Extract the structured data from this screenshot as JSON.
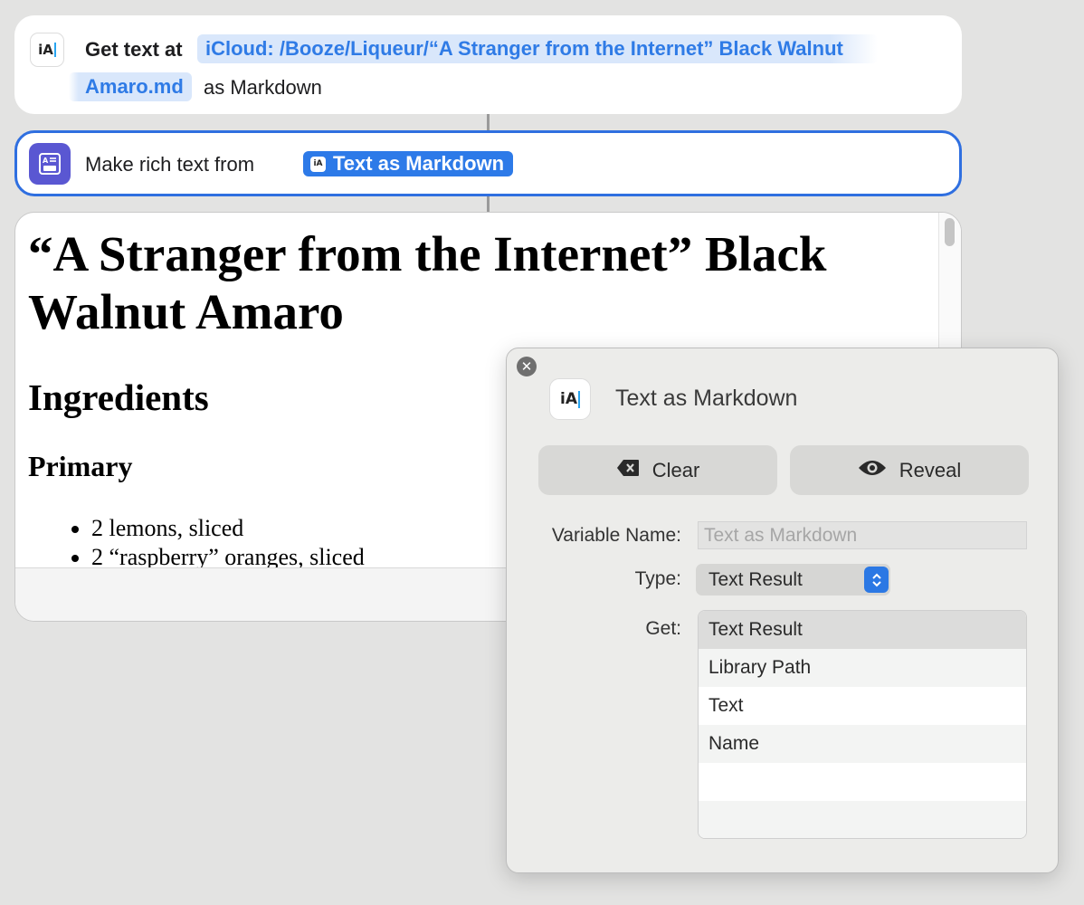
{
  "action1": {
    "label": "Get text at",
    "path_line1": "iCloud: /Booze/Liqueur/“A Stranger from the Internet” Black Walnut",
    "path_line2": "Amaro.md",
    "suffix": "as Markdown",
    "icon_text": "iA"
  },
  "action2": {
    "label": "Make rich text from",
    "variable": "Text as Markdown",
    "variable_icon_text": "iA"
  },
  "preview": {
    "title": "“A Stranger from the Internet” Black Walnut Amaro",
    "heading2": "Ingredients",
    "heading3": "Primary",
    "items": [
      "2 lemons, sliced",
      "2 “raspberry” oranges, sliced"
    ]
  },
  "popover": {
    "icon_text": "iA",
    "title": "Text as Markdown",
    "clear_label": "Clear",
    "reveal_label": "Reveal",
    "variable_name_label": "Variable Name:",
    "variable_name_placeholder": "Text as Markdown",
    "type_label": "Type:",
    "type_value": "Text Result",
    "get_label": "Get:",
    "get_options": [
      "Text Result",
      "Library Path",
      "Text",
      "Name",
      "",
      ""
    ],
    "selected_option": "Text Result"
  },
  "colors": {
    "accent": "#2f6fe0",
    "token_bg": "#d9e7fb",
    "token_text": "#2f7be6",
    "rich_text_icon": "#5a57d2"
  }
}
